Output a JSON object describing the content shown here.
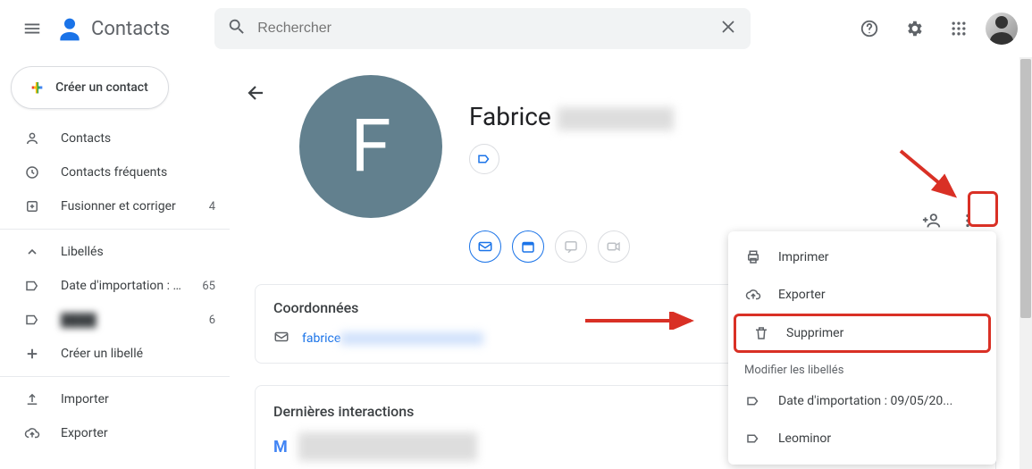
{
  "header": {
    "app_title": "Contacts",
    "search_placeholder": "Rechercher"
  },
  "sidebar": {
    "create_label": "Créer un contact",
    "items": [
      {
        "label": "Contacts",
        "count": ""
      },
      {
        "label": "Contacts fréquents",
        "count": ""
      },
      {
        "label": "Fusionner et corriger",
        "count": "4"
      }
    ],
    "labels_header": "Libellés",
    "labels": [
      {
        "label": "Date d'importation : ...",
        "count": "65"
      },
      {
        "label": "████",
        "count": "6"
      }
    ],
    "create_label_item": "Créer un libellé",
    "import_label": "Importer",
    "export_label": "Exporter"
  },
  "contact": {
    "initial": "F",
    "name_visible": "Fabrice",
    "card_coord_title": "Coordonnées",
    "email_visible": "fabrice",
    "card_inter_title": "Dernières interactions"
  },
  "menu": {
    "print": "Imprimer",
    "export": "Exporter",
    "delete": "Supprimer",
    "modify_labels": "Modifier les libellés",
    "label1": "Date d'importation : 09/05/20...",
    "label2": "Leominor"
  }
}
